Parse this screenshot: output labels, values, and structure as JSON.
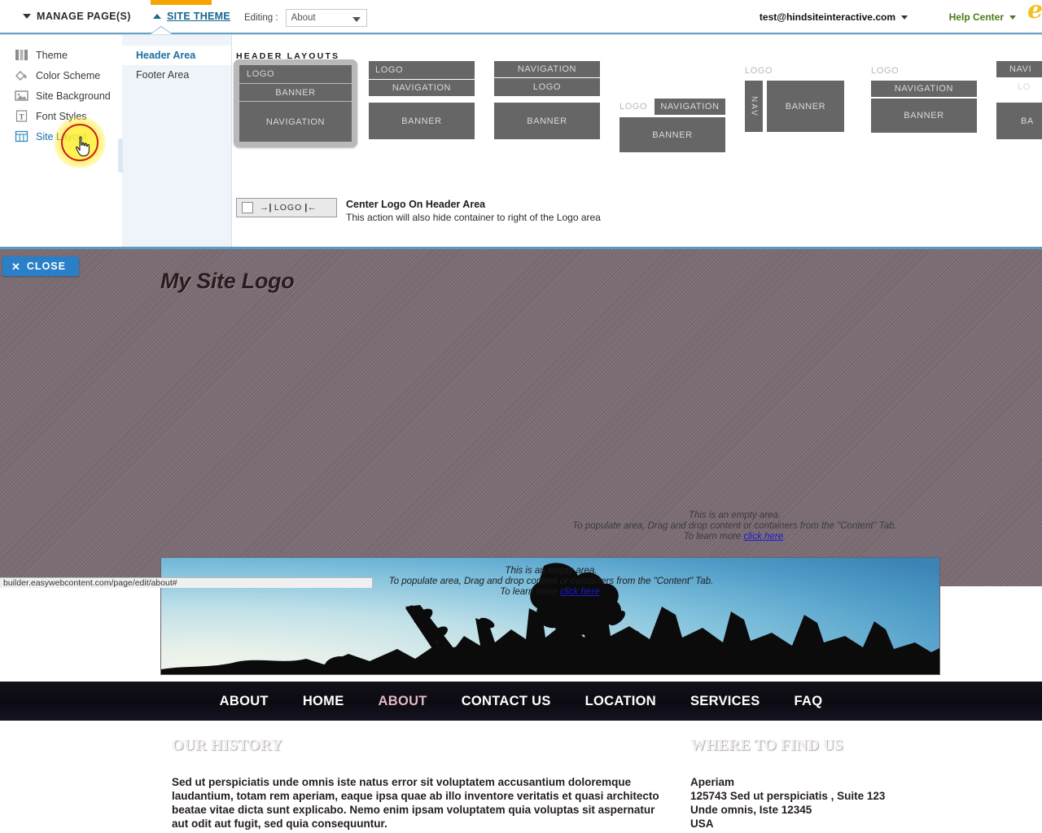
{
  "topbar": {
    "manage_pages": "MANAGE PAGE(S)",
    "site_theme": "SITE THEME",
    "editing_label": "Editing :",
    "editing_value": "About",
    "account": "test@hindsiteinteractive.com",
    "help_center": "Help Center",
    "brand_initial": "e"
  },
  "sidebar": {
    "items": [
      {
        "label": "Theme",
        "icon": "columns-icon"
      },
      {
        "label": "Color Scheme",
        "icon": "paint-bucket-icon"
      },
      {
        "label": "Site Background",
        "icon": "image-icon"
      },
      {
        "label": "Font Styles",
        "icon": "text-t-icon"
      },
      {
        "label": "Site Layout",
        "icon": "grid-table-icon"
      }
    ],
    "active_index": 4
  },
  "subpanel": {
    "items": [
      "Header Area",
      "Footer Area"
    ],
    "active_index": 0
  },
  "header_layouts": {
    "title": "HEADER LAYOUTS",
    "options": [
      {
        "name": "logo-banner-navigation",
        "blocks": [
          "LOGO",
          "BANNER",
          "NAVIGATION"
        ],
        "selected": true
      },
      {
        "name": "logo-navigation-banner",
        "blocks": [
          "LOGO",
          "NAVIGATION",
          "BANNER"
        ],
        "selected": false
      },
      {
        "name": "navigation-logo-banner",
        "blocks": [
          "NAVIGATION",
          "LOGO",
          "BANNER"
        ],
        "selected": false
      },
      {
        "name": "logo-inline-navigation-banner",
        "blocks": [
          "LOGO",
          "NAVIGATION",
          "BANNER"
        ],
        "selected": false
      },
      {
        "name": "logo-vertical-nav-banner",
        "blocks": [
          "LOGO",
          "NAV",
          "BANNER"
        ],
        "selected": false
      },
      {
        "name": "logo-stacked-navigation-banner",
        "blocks": [
          "LOGO",
          "NAVIGATION",
          "BANNER"
        ],
        "selected": false
      },
      {
        "name": "navigation-logo-banner-partial",
        "blocks": [
          "NAVI",
          "LO",
          "BA"
        ],
        "selected": false
      }
    ]
  },
  "center_logo": {
    "checked": false,
    "button_arrow_left": "→|",
    "button_label": "LOGO",
    "button_arrow_right": "|←",
    "title": "Center Logo On Header Area",
    "description": "This action will also hide container to right of the Logo area"
  },
  "scrollbar": {
    "grip": "III"
  },
  "preview": {
    "close_button": "CLOSE",
    "close_icon": "✕",
    "site_logo": "My Site Logo",
    "empty_area": {
      "line1": "This is an empty area.",
      "line2": "To populate area, Drag and drop content or containers from the \"Content\" Tab.",
      "line3_prefix": "To learn more ",
      "link": "click here",
      "line3_suffix": "."
    },
    "nav": [
      {
        "label": "ABOUT",
        "active": false
      },
      {
        "label": "HOME",
        "active": false
      },
      {
        "label": "ABOUT",
        "active": true
      },
      {
        "label": "CONTACT US",
        "active": false
      },
      {
        "label": "LOCATION",
        "active": false
      },
      {
        "label": "SERVICES",
        "active": false
      },
      {
        "label": "FAQ",
        "active": false
      }
    ],
    "footer": {
      "left": {
        "heading": "OUR HISTORY",
        "body": "Sed ut perspiciatis unde omnis iste natus error sit voluptatem accusantium doloremque laudantium, totam rem aperiam, eaque ipsa quae ab illo inventore veritatis et quasi architecto beatae vitae dicta sunt explicabo. Nemo enim ipsam voluptatem quia voluptas sit aspernatur aut odit aut fugit, sed quia consequuntur."
      },
      "right": {
        "heading": "WHERE TO FIND US",
        "line1": "Aperiam",
        "line2": "125743 Sed ut perspiciatis , Suite 123",
        "line3": "Unde omnis, Iste 12345",
        "line4": "USA"
      }
    }
  },
  "status_bar": {
    "url": "builder.easywebcontent.com/page/edit/about#"
  },
  "colors": {
    "accent_orange": "#f5a400",
    "link_blue": "#16668c",
    "close_blue": "#2a7fc9",
    "help_green": "#4a7a16",
    "preview_bg": "#7d6d75",
    "nav_bg": "#0c0b12",
    "nav_active": "#e3b8c6",
    "click_ring": "#cc1f1f",
    "click_glow": "#fff33c"
  }
}
